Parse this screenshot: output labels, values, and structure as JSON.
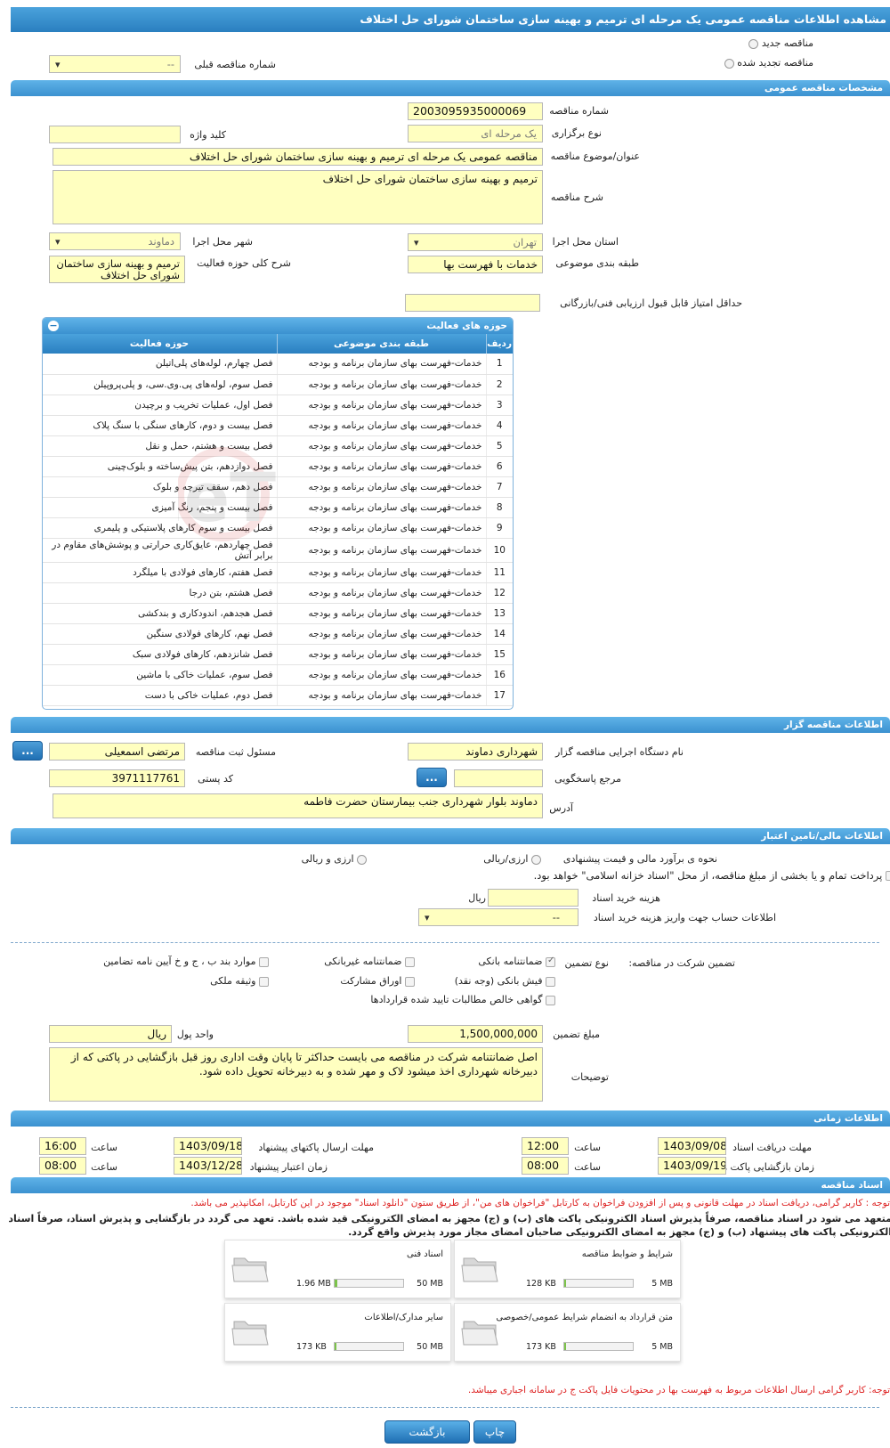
{
  "page_title": "مشاهده اطلاعات مناقصه عمومی یک مرحله ای ترمیم و بهینه سازی ساختمان شورای حل اختلاف",
  "tender_type": {
    "new_label": "مناقصه جدید",
    "renewed_label": "مناقصه تجدید شده",
    "prev_number_label": "شماره مناقصه قبلی",
    "prev_number_value": "--"
  },
  "general": {
    "section_title": "مشخصات مناقصه عمومی",
    "number_label": "شماره مناقصه",
    "number_value": "2003095935000069",
    "holding_type_label": "نوع برگزاری",
    "holding_type_value": "یک مرحله ای",
    "keyword_label": "کلید واژه",
    "keyword_value": "",
    "subject_label": "عنوان/موضوع مناقصه",
    "subject_value": "مناقصه عمومی یک مرحله ای ترمیم و بهینه سازی ساختمان شورای حل اختلاف",
    "description_label": "شرح مناقصه",
    "description_value": "ترمیم و بهینه سازی ساختمان شورای حل اختلاف",
    "province_label": "استان محل اجرا",
    "province_value": "تهران",
    "city_label": "شهر محل اجرا",
    "city_value": "دماوند",
    "category_label": "طبقه بندی موضوعی",
    "category_value": "خدمات با فهرست بها",
    "activity_desc_label": "شرح کلی حوزه فعالیت",
    "activity_desc_value": "ترمیم و بهینه سازی ساختمان شورای حل اختلاف",
    "min_score_label": "حداقل امتیاز قابل قبول ارزیابی فنی/بازرگانی",
    "min_score_value": ""
  },
  "activities": {
    "title": "حوزه های فعالیت",
    "col_row": "ردیف",
    "col_category": "طبقه بندی موضوعی",
    "col_field": "حوزه فعالیت",
    "rows": [
      {
        "n": "1",
        "cat": "خدمات-فهرست بهای سازمان برنامه و بودجه",
        "field": "فصل چهارم، لوله‌های پلی‌اتیلن"
      },
      {
        "n": "2",
        "cat": "خدمات-فهرست بهای سازمان برنامه و بودجه",
        "field": "فصل سوم، لوله‌های پی.وی.سی، و پلی‌پروپیلن"
      },
      {
        "n": "3",
        "cat": "خدمات-فهرست بهای سازمان برنامه و بودجه",
        "field": "فصل اول، عملیات تخریب و برچیدن"
      },
      {
        "n": "4",
        "cat": "خدمات-فهرست بهای سازمان برنامه و بودجه",
        "field": "فصل بیست و دوم، کارهای سنگی با سنگ پلاک"
      },
      {
        "n": "5",
        "cat": "خدمات-فهرست بهای سازمان برنامه و بودجه",
        "field": "فصل بیست و هشتم، حمل و نقل"
      },
      {
        "n": "6",
        "cat": "خدمات-فهرست بهای سازمان برنامه و بودجه",
        "field": "فصل دوازدهم، بتن پیش‌ساخته و بلوک‌چینی"
      },
      {
        "n": "7",
        "cat": "خدمات-فهرست بهای سازمان برنامه و بودجه",
        "field": "فصل دهم، سقف تیرچه و بلوک"
      },
      {
        "n": "8",
        "cat": "خدمات-فهرست بهای سازمان برنامه و بودجه",
        "field": "فصل بیست و پنجم، رنگ آمیزی"
      },
      {
        "n": "9",
        "cat": "خدمات-فهرست بهای سازمان برنامه و بودجه",
        "field": "فصل بیست و سوم کارهای پلاستیکی و پلیمری"
      },
      {
        "n": "10",
        "cat": "خدمات-فهرست بهای سازمان برنامه و بودجه",
        "field": "فصل چهاردهم، عایق‌کاری حرارتی و پوشش‌های مقاوم در برابر آتش"
      },
      {
        "n": "11",
        "cat": "خدمات-فهرست بهای سازمان برنامه و بودجه",
        "field": "فصل هفتم، کارهای فولادی با میلگرد"
      },
      {
        "n": "12",
        "cat": "خدمات-فهرست بهای سازمان برنامه و بودجه",
        "field": "فصل هشتم، بتن درجا"
      },
      {
        "n": "13",
        "cat": "خدمات-فهرست بهای سازمان برنامه و بودجه",
        "field": "فصل هجدهم، اندودکاری و بندکشی"
      },
      {
        "n": "14",
        "cat": "خدمات-فهرست بهای سازمان برنامه و بودجه",
        "field": "فصل نهم، کارهای فولادی سنگین"
      },
      {
        "n": "15",
        "cat": "خدمات-فهرست بهای سازمان برنامه و بودجه",
        "field": "فصل شانزدهم، کارهای فولادی سبک"
      },
      {
        "n": "16",
        "cat": "خدمات-فهرست بهای سازمان برنامه و بودجه",
        "field": "فصل سوم، عملیات خاکی با ماشین"
      },
      {
        "n": "17",
        "cat": "خدمات-فهرست بهای سازمان برنامه و بودجه",
        "field": "فصل دوم، عملیات خاکی با دست"
      }
    ]
  },
  "organizer": {
    "section_title": "اطلاعات مناقصه گزار",
    "agency_label": "نام دستگاه اجرایی مناقصه گزار",
    "agency_value": "شهرداری دماوند",
    "registrar_label": "مسئول ثبت مناقصه",
    "registrar_value": "مرتضی اسمعیلی",
    "dots_label": "...",
    "reference_label": "مرجع پاسخگویی",
    "reference_value": "",
    "postal_label": "کد پستی",
    "postal_value": "3971117761",
    "address_label": "آدرس",
    "address_value": "دماوند بلوار شهرداری  جنب بیمارستان حضرت فاطمه"
  },
  "financial": {
    "section_title": "اطلاعات مالی/تامین اعتبار",
    "estimate_label": "نحوه ی برآورد مالی و قیمت پیشنهادی",
    "opt_rial": "ارزی/ریالی",
    "opt_currency": "ارزی و ریالی",
    "payment_note": "پرداخت تمام و یا بخشی از مبلغ مناقصه، از محل \"اسناد خزانه اسلامی\" خواهد بود.",
    "doc_cost_label": "هزینه خرید اسناد",
    "doc_cost_value": "",
    "doc_cost_unit": "ریال",
    "account_label": "اطلاعات حساب جهت واریز هزینه خرید اسناد",
    "account_value": "--",
    "guarantee_participation_label": "تضمین شرکت در مناقصه:",
    "guarantee_type_label": "نوع تضمین",
    "g_bank": "ضمانتنامه بانکی",
    "g_nonbank": "ضمانتنامه غیربانکی",
    "g_bcj": "موارد بند ب ، ج و خ آیین نامه تضامین",
    "g_check": "فیش بانکی (وجه نقد)",
    "g_bonds": "اوراق مشارکت",
    "g_property": "وثیقه ملکی",
    "g_claims": "گواهی خالص مطالبات تایید شده قراردادها",
    "amount_label": "مبلغ تضمین",
    "amount_value": "1,500,000,000",
    "currency_label": "واحد پول",
    "currency_value": "ریال",
    "notes_label": "توضیحات",
    "notes_value": "اصل ضمانتنامه شرکت در مناقصه می بایست حداکثر تا پایان وقت اداری روز قبل بازگشایی در پاکتی که از دبیرخانه شهرداری اخذ میشود لاک و مهر شده و به دبیرخانه تحویل داده شود."
  },
  "timing": {
    "section_title": "اطلاعات زمانی",
    "doc_deadline_label": "مهلت دریافت اسناد",
    "doc_deadline_date": "1403/09/08",
    "doc_deadline_time": "12:00",
    "send_deadline_label": "مهلت ارسال پاکتهای پیشنهاد",
    "send_deadline_date": "1403/09/18",
    "send_deadline_time": "16:00",
    "opening_label": "زمان بازگشایی پاکت ها",
    "opening_date": "1403/09/19",
    "opening_time": "08:00",
    "validity_label": "زمان اعتبار پیشنهاد",
    "validity_date": "1403/12/28",
    "validity_time": "08:00",
    "time_label": "ساعت"
  },
  "documents": {
    "section_title": "اسناد مناقصه",
    "note1": "توجه : کاربر گرامی، دریافت اسناد در مهلت قانونی و پس از افزودن فراخوان به کارتابل \"فراخوان های من\"، از طریق ستون \"دانلود اسناد\" موجود در این کارتابل، امکانپذیر می باشد.",
    "note2": "متعهد می شود در اسناد مناقصه، صرفاً پذیرش اسناد الکترونیکی پاکت های (ب) و (ج) مجهز به امضای الکترونیکی قید شده باشد. تعهد می گردد در بازگشایی و پذیرش اسناد، صرفاً اسناد الکترونیکی پاکت های پیشنهاد (ب) و (ج) مجهز به امضای الکترونیکی صاحبان امضای مجاز مورد پذیرش واقع گردد.",
    "files": [
      {
        "name": "شرایط و ضوابط مناقصه",
        "used": "128 KB",
        "max": "5 MB",
        "fill": 0.03
      },
      {
        "name": "اسناد فنی",
        "used": "1.96 MB",
        "max": "50 MB",
        "fill": 0.04
      },
      {
        "name": "متن قرارداد به انضمام شرایط عمومی/خصوصی",
        "used": "173 KB",
        "max": "5 MB",
        "fill": 0.03
      },
      {
        "name": "سایر مدارک/اطلاعات",
        "used": "173 KB",
        "max": "50 MB",
        "fill": 0.01
      }
    ],
    "note3": "توجه: کاربر گرامی ارسال اطلاعات مربوط به فهرست بها در محتویات فایل پاکت ج در سامانه اجباری میباشد."
  },
  "actions": {
    "print_label": "چاپ",
    "back_label": "بازگشت"
  },
  "watermark_text": "AriaTender.neT"
}
